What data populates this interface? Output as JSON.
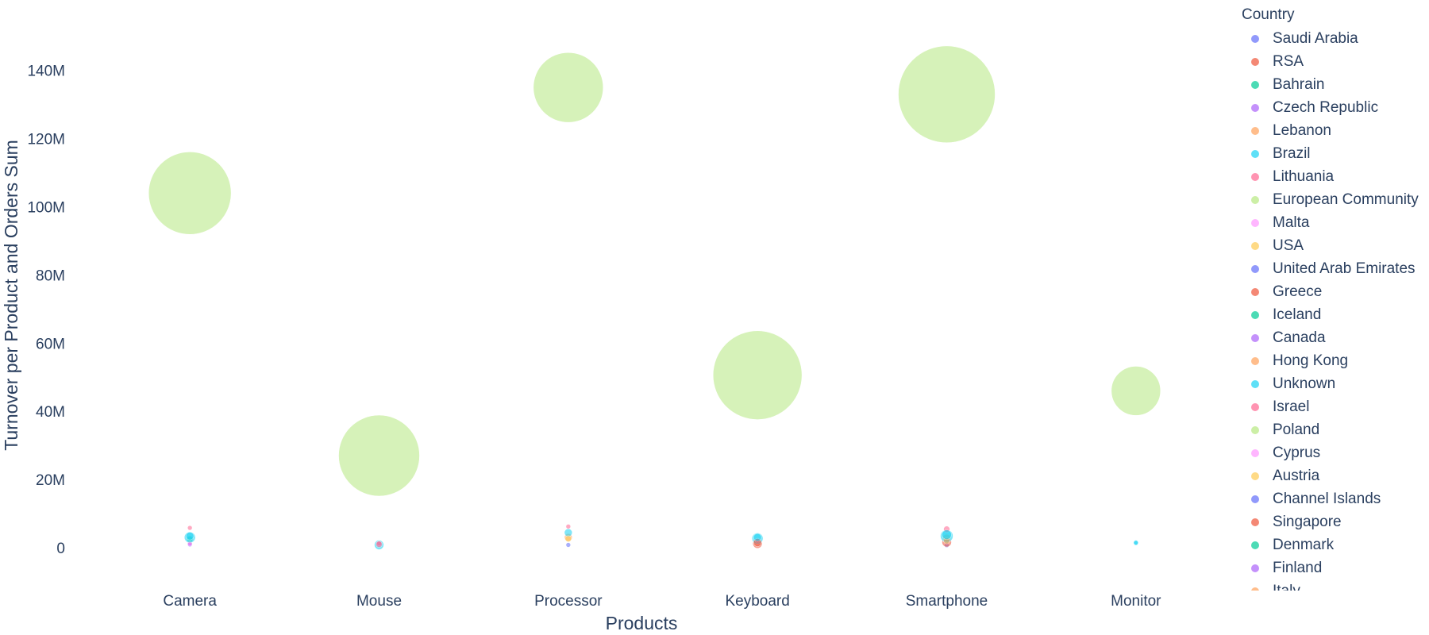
{
  "palette": [
    "#636efa",
    "#EF553B",
    "#00cc96",
    "#ab63fa",
    "#FFA15A",
    "#19d3f3",
    "#FF6692",
    "#B6E880",
    "#FF97FF",
    "#FECB52"
  ],
  "chart_data": {
    "type": "scatter",
    "bubble": true,
    "title": "",
    "xlabel": "Products",
    "ylabel": "Turnover per Product and Orders Sum",
    "categories": [
      "Camera",
      "Mouse",
      "Processor",
      "Keyboard",
      "Smartphone",
      "Monitor"
    ],
    "ylim": [
      -7000000,
      156000000
    ],
    "yticks": [
      0,
      20000000,
      40000000,
      60000000,
      80000000,
      100000000,
      120000000,
      140000000
    ],
    "ytick_labels": [
      "0",
      "20M",
      "40M",
      "60M",
      "80M",
      "100M",
      "120M",
      "140M"
    ],
    "grid": false,
    "legend_title": "Country",
    "legend_position": "right",
    "series": [
      {
        "name": "Saudi Arabia",
        "points": [
          {
            "x": "Camera",
            "y": 900000,
            "size": 3
          },
          {
            "x": "Processor",
            "y": 800000,
            "size": 3
          },
          {
            "x": "Smartphone",
            "y": 700000,
            "size": 3
          }
        ]
      },
      {
        "name": "RSA",
        "points": [
          {
            "x": "Camera",
            "y": 1500000,
            "size": 3
          },
          {
            "x": "Keyboard",
            "y": 1200000,
            "size": 6
          },
          {
            "x": "Smartphone",
            "y": 1600000,
            "size": 6
          }
        ]
      },
      {
        "name": "Bahrain",
        "points": [
          {
            "x": "Camera",
            "y": 2500000,
            "size": 4
          },
          {
            "x": "Smartphone",
            "y": 2200000,
            "size": 4
          }
        ]
      },
      {
        "name": "Czech Republic",
        "points": [
          {
            "x": "Camera",
            "y": 1200000,
            "size": 3
          },
          {
            "x": "Keyboard",
            "y": 1900000,
            "size": 3
          }
        ]
      },
      {
        "name": "Lebanon",
        "points": [
          {
            "x": "Processor",
            "y": 3000000,
            "size": 5
          },
          {
            "x": "Smartphone",
            "y": 2800000,
            "size": 5
          }
        ]
      },
      {
        "name": "Brazil",
        "points": [
          {
            "x": "Camera",
            "y": 3000000,
            "size": 7
          },
          {
            "x": "Mouse",
            "y": 800000,
            "size": 6
          },
          {
            "x": "Processor",
            "y": 4400000,
            "size": 5
          },
          {
            "x": "Keyboard",
            "y": 2700000,
            "size": 7
          },
          {
            "x": "Smartphone",
            "y": 3400000,
            "size": 8
          },
          {
            "x": "Monitor",
            "y": 1300000,
            "size": 3
          }
        ]
      },
      {
        "name": "Lithuania",
        "points": [
          {
            "x": "Camera",
            "y": 5800000,
            "size": 3
          },
          {
            "x": "Mouse",
            "y": 1200000,
            "size": 3
          },
          {
            "x": "Processor",
            "y": 6200000,
            "size": 3
          },
          {
            "x": "Keyboard",
            "y": 2100000,
            "size": 3
          },
          {
            "x": "Smartphone",
            "y": 5400000,
            "size": 4
          }
        ]
      },
      {
        "name": "European Community",
        "points": [
          {
            "x": "Camera",
            "y": 104000000,
            "size": 52
          },
          {
            "x": "Mouse",
            "y": 27000000,
            "size": 51
          },
          {
            "x": "Processor",
            "y": 135000000,
            "size": 44
          },
          {
            "x": "Keyboard",
            "y": 50600000,
            "size": 56
          },
          {
            "x": "Smartphone",
            "y": 133000000,
            "size": 61
          },
          {
            "x": "Monitor",
            "y": 46000000,
            "size": 31
          }
        ]
      },
      {
        "name": "Malta",
        "points": [
          {
            "x": "Camera",
            "y": 1000000,
            "size": 3
          }
        ]
      },
      {
        "name": "USA",
        "points": [
          {
            "x": "Processor",
            "y": 2600000,
            "size": 4
          }
        ]
      },
      {
        "name": "United Arab Emirates",
        "points": []
      },
      {
        "name": "Greece",
        "points": [
          {
            "x": "Keyboard",
            "y": 1500000,
            "size": 5
          }
        ]
      },
      {
        "name": "Iceland",
        "points": []
      },
      {
        "name": "Canada",
        "points": []
      },
      {
        "name": "Hong Kong",
        "points": [
          {
            "x": "Smartphone",
            "y": 2000000,
            "size": 4
          }
        ]
      },
      {
        "name": "Unknown",
        "points": [
          {
            "x": "Camera",
            "y": 3400000,
            "size": 5
          },
          {
            "x": "Keyboard",
            "y": 3000000,
            "size": 5
          },
          {
            "x": "Smartphone",
            "y": 3800000,
            "size": 6
          },
          {
            "x": "Monitor",
            "y": 1500000,
            "size": 3
          }
        ]
      },
      {
        "name": "Israel",
        "points": [
          {
            "x": "Mouse",
            "y": 1000000,
            "size": 4
          }
        ]
      },
      {
        "name": "Poland",
        "points": []
      },
      {
        "name": "Cyprus",
        "points": []
      },
      {
        "name": "Austria",
        "points": []
      },
      {
        "name": "Channel Islands",
        "points": []
      },
      {
        "name": "Singapore",
        "points": []
      },
      {
        "name": "Denmark",
        "points": []
      },
      {
        "name": "Finland",
        "points": []
      },
      {
        "name": "Italy",
        "points": []
      }
    ]
  }
}
